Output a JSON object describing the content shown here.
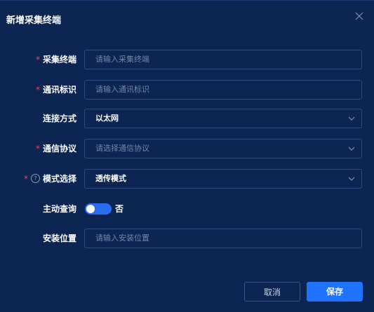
{
  "dialog": {
    "title": "新增采集终端",
    "close_icon": "close-icon"
  },
  "form": {
    "terminal": {
      "label": "采集终端",
      "required": true,
      "placeholder": "请输入采集终端"
    },
    "comm_id": {
      "label": "通讯标识",
      "required": true,
      "placeholder": "请输入通讯标识"
    },
    "connection": {
      "label": "连接方式",
      "required": false,
      "value": "以太网"
    },
    "protocol": {
      "label": "通信协议",
      "required": true,
      "placeholder": "请选择通信协议"
    },
    "mode": {
      "label": "模式选择",
      "required": true,
      "help_icon": "?",
      "value": "透传模式"
    },
    "active_query": {
      "label": "主动查询",
      "toggle_text": "否"
    },
    "location": {
      "label": "安装位置",
      "required": false,
      "placeholder": "请输入安装位置"
    }
  },
  "buttons": {
    "cancel": "取消",
    "save": "保存"
  },
  "colors": {
    "background": "#0c2552",
    "accent": "#1f74ff",
    "required": "#e5484d"
  }
}
